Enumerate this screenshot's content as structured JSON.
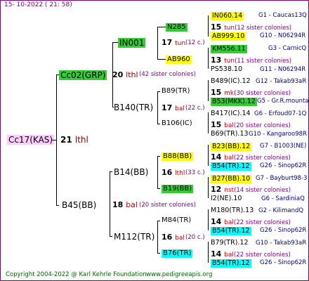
{
  "header": {
    "timestamp": "15- 10-2022 ( 21: 58)"
  },
  "footer": {
    "copyright": "Copyright 2004-2022 @ Karl Kehrle Foundation",
    "site": "www.pedigreeapis.org"
  },
  "root": {
    "name": "Cc17(KAS)",
    "year": "21",
    "note": "lthl"
  },
  "gen1": [
    {
      "name": "Cc02(GRP)",
      "year": "20",
      "note": "lthl",
      "sisters": "(42 sister colonies)"
    },
    {
      "name": "B45(BB)",
      "year": "18",
      "note": "bal",
      "sisters": "(20 sister colonies)"
    }
  ],
  "gen2": [
    {
      "name": "IN001",
      "year": "17",
      "note": "tun",
      "sisters": "(12 c.)"
    },
    {
      "name": "B140(TR)",
      "year": "17",
      "note": "bal",
      "sisters": "(22 c.)"
    },
    {
      "name": "B14(BB)",
      "year": "16",
      "note": "lthl",
      "sisters": "(33 c.)"
    },
    {
      "name": "M112(TR)",
      "year": "16",
      "note": "bal",
      "sisters": "(20 c.)"
    }
  ],
  "gen3": [
    {
      "name": "N285"
    },
    {
      "name": "AB960"
    },
    {
      "name": "B89(TR)"
    },
    {
      "name": "B106(IC)"
    },
    {
      "name": "B88(BB)"
    },
    {
      "name": "B19(BB)"
    },
    {
      "name": "M84(TR)"
    },
    {
      "name": "B76(TR)"
    }
  ],
  "gen4": [
    {
      "name": "IN060.14",
      "cat": "G1 - Caucas13Q"
    },
    {
      "year": "15",
      "note": "tun",
      "sisters": "(12 sister colonies)"
    },
    {
      "name": "AB999.10",
      "cat": "G10 - N06294R"
    },
    {
      "name": "KM556.11",
      "cat": "G3 - CarnicQ"
    },
    {
      "year": "13",
      "note": "tun",
      "sisters": "(11 sister colonies)"
    },
    {
      "name": "PS538.10",
      "cat": "G11 - N06294R"
    },
    {
      "name": "B489(IC).12",
      "cat": "G12 - Takab93aR"
    },
    {
      "year": "15",
      "note": "mk",
      "sisters": "(30 sister colonies)"
    },
    {
      "name": "B53(MKK).12",
      "cat": "G5 - Gr.R.mounta"
    },
    {
      "name": "B417(IC).14",
      "cat": "G6 - Erfoud07-1Q"
    },
    {
      "year": "15",
      "note": "bal",
      "sisters": "(20 sister colonies)"
    },
    {
      "name": "B69(TR).13",
      "cat": "G10 - Kangaroo98R"
    },
    {
      "name": "B23(BB).12",
      "cat": "G7 - B1003(NE)"
    },
    {
      "year": "14",
      "note": "bal",
      "sisters": "(22 sister colonies)"
    },
    {
      "name": "B54(TR).12",
      "cat": "G26 - Sinop62R"
    },
    {
      "name": "B27(BB).10",
      "cat": "G7 - Bayburt98-3"
    },
    {
      "year": "12",
      "note": "nst",
      "sisters": "(14 sister colonies)"
    },
    {
      "name": "I2(NE).10",
      "cat": "G6 - SardiniaQ"
    },
    {
      "name": "M180(TR).13",
      "cat": "G2 - KilimandQ"
    },
    {
      "year": "14",
      "note": "bal",
      "sisters": "(22 sister colonies)"
    },
    {
      "name": "B54(TR).12",
      "cat": "G26 - Sinop62R"
    },
    {
      "name": "B79(TR).12",
      "cat": "G10 - Takab93aR"
    },
    {
      "year": "14",
      "note": "bal",
      "sisters": "(22 sister colonies)"
    },
    {
      "name": "B54(TR).12",
      "cat": "G26 - Sinop62R"
    }
  ]
}
